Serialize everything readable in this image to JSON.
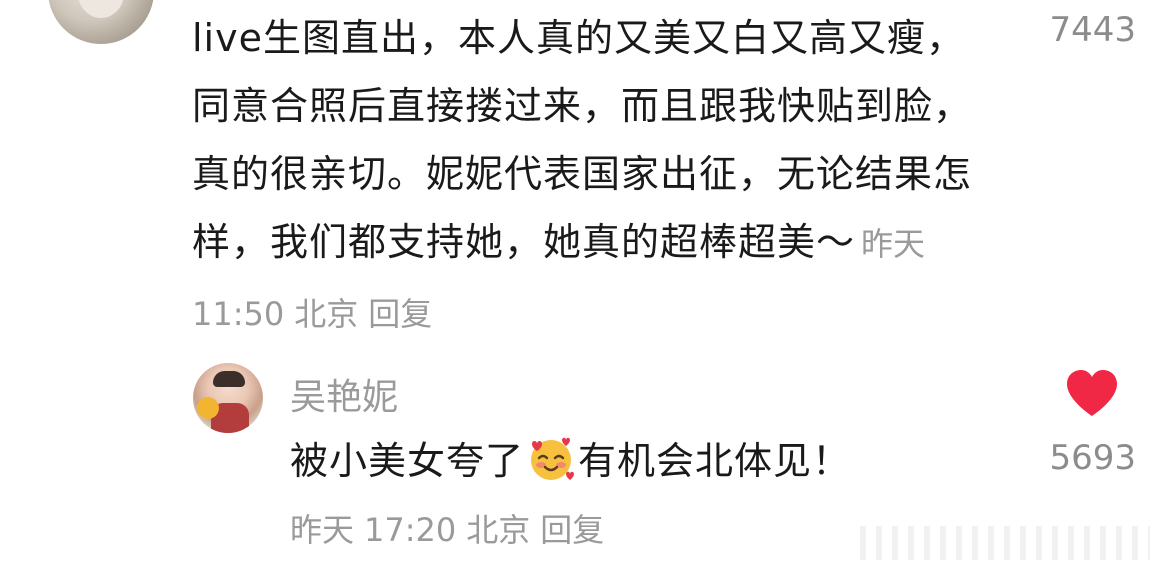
{
  "comment": {
    "text": "live生图直出，本人真的又美又白又高又瘦，同意合照后直接搂过来，而且跟我快贴到脸，真的很亲切。妮妮代表国家出征，无论结果怎样，我们都支持她，她真的超棒超美～",
    "date": "昨天",
    "time": "11:50",
    "location": "北京",
    "reply_label": "回复",
    "like_count": "7443"
  },
  "reply": {
    "author": "吴艳妮",
    "text_before_emoji": "被小美女夸了",
    "emoji_name": "smiling-face-with-hearts-icon",
    "text_after_emoji": "有机会北体见！",
    "date": "昨天",
    "time": "17:20",
    "location": "北京",
    "reply_label": "回复",
    "like_count": "5693",
    "like_icon": "heart-icon",
    "like_color": "#f02845"
  }
}
